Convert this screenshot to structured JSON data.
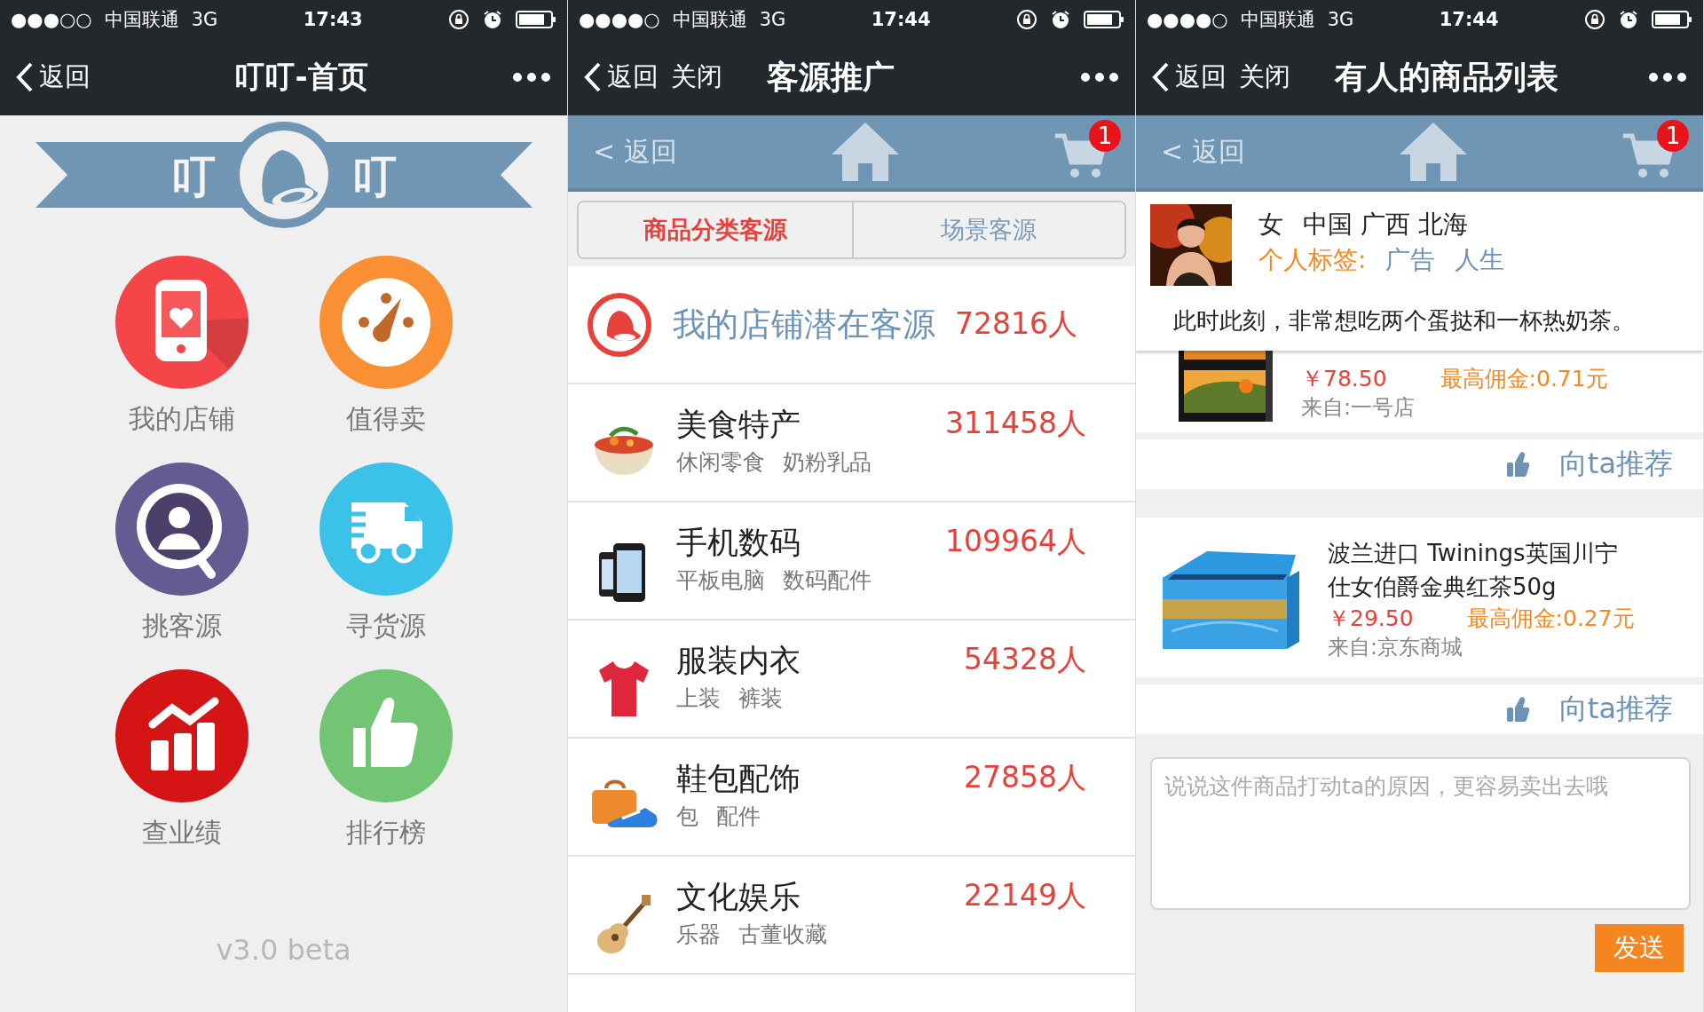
{
  "screens": [
    {
      "kind": "home",
      "status": {
        "signal": "●●●○○",
        "carrier": "中国联通",
        "network": "3G",
        "time": "17:43"
      },
      "nav": {
        "back": "返回",
        "title": "叮叮-首页"
      },
      "logo": {
        "left": "叮",
        "right": "叮"
      },
      "tiles": [
        {
          "kind": "phone-heart",
          "label": "我的店铺",
          "color": "#f44649"
        },
        {
          "kind": "gauge",
          "label": "值得卖",
          "color": "#fb8f33"
        },
        {
          "kind": "person-search",
          "label": "挑客源",
          "color": "#665a92"
        },
        {
          "kind": "truck",
          "label": "寻货源",
          "color": "#3cc1e8"
        },
        {
          "kind": "chart",
          "label": "查业绩",
          "color": "#d51515"
        },
        {
          "kind": "thumbs-up",
          "label": "排行榜",
          "color": "#72c573"
        }
      ],
      "version": "v3.0 beta"
    },
    {
      "kind": "sources",
      "status": {
        "signal": "●●●●○",
        "carrier": "中国联通",
        "network": "3G",
        "time": "17:44"
      },
      "nav": {
        "back": "返回",
        "close": "关闭",
        "title": "客源推广"
      },
      "toolbar": {
        "back": "< 返回",
        "cart_count": "1"
      },
      "segments": [
        {
          "label": "商品分类客源",
          "selected": true
        },
        {
          "label": "场景客源",
          "selected": false
        }
      ],
      "featured": {
        "title": "我的店铺潜在客源",
        "count": "72816人"
      },
      "categories": [
        {
          "kind": "food",
          "name": "美食特产",
          "tags": [
            "休闲零食",
            "奶粉乳品"
          ],
          "count": "311458人"
        },
        {
          "kind": "phone",
          "name": "手机数码",
          "tags": [
            "平板电脑",
            "数码配件"
          ],
          "count": "109964人"
        },
        {
          "kind": "shirt",
          "name": "服装内衣",
          "tags": [
            "上装",
            "裤装"
          ],
          "count": "54328人"
        },
        {
          "kind": "bag",
          "name": "鞋包配饰",
          "tags": [
            "包",
            "配件"
          ],
          "count": "27858人"
        },
        {
          "kind": "ukulele",
          "name": "文化娱乐",
          "tags": [
            "乐器",
            "古董收藏"
          ],
          "count": "22149人"
        }
      ]
    },
    {
      "kind": "products",
      "status": {
        "signal": "●●●●○",
        "carrier": "中国联通",
        "network": "3G",
        "time": "17:44"
      },
      "nav": {
        "back": "返回",
        "close": "关闭",
        "title": "有人的商品列表"
      },
      "toolbar": {
        "back": "< 返回",
        "cart_count": "1"
      },
      "customer": {
        "gender": "女",
        "location": "中国 广西 北海",
        "tags_label": "个人标签:",
        "tags": [
          "广告",
          "人生"
        ],
        "message": "此时此刻，非常想吃两个蛋挞和一杯热奶茶。"
      },
      "products": [
        {
          "kind": "dark-box",
          "obscured": true,
          "price": "￥78.50",
          "commission": "最高佣金:0.71元",
          "source": "来自:一号店",
          "recommend": "向ta推荐"
        },
        {
          "kind": "blue-box",
          "obscured": false,
          "title": "波兰进口 Twinings英国川宁仕女伯爵金典红茶50g",
          "price": "￥29.50",
          "commission": "最高佣金:0.27元",
          "source": "来自:京东商城",
          "recommend": "向ta推荐"
        }
      ],
      "comment": {
        "placeholder": "说说这件商品打动ta的原因，更容易卖出去哦"
      },
      "send": "发送"
    }
  ]
}
